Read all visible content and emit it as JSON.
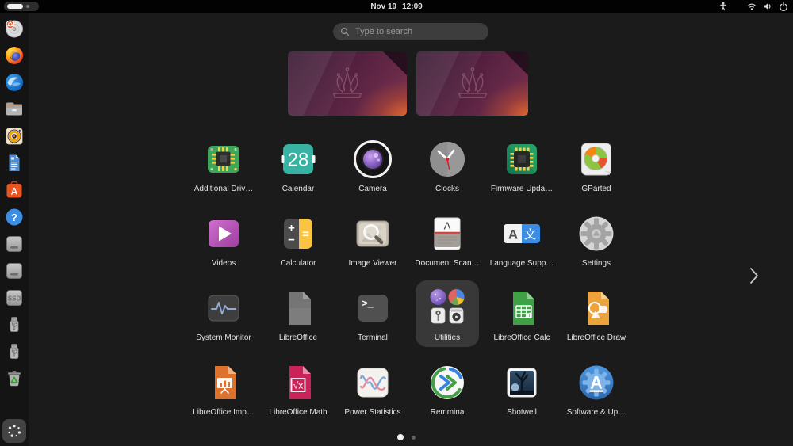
{
  "topbar": {
    "date": "Nov 19",
    "time": "12:09",
    "workspace_indicator": {
      "total": 2,
      "active": 1
    },
    "status_icons": [
      "accessibility-icon",
      "wifi-icon",
      "volume-icon",
      "power-icon"
    ]
  },
  "search": {
    "placeholder": "Type to search"
  },
  "workspaces": {
    "count": 2
  },
  "dock": {
    "items": [
      {
        "name": "install-ubuntu"
      },
      {
        "name": "firefox"
      },
      {
        "name": "thunderbird"
      },
      {
        "name": "files"
      },
      {
        "name": "rhythmbox"
      },
      {
        "name": "libreoffice-writer"
      },
      {
        "name": "app-center",
        "glyph": "A"
      },
      {
        "name": "help",
        "glyph": "?"
      },
      {
        "name": "hard-drive-1"
      },
      {
        "name": "hard-drive-2"
      },
      {
        "name": "ssd-drive",
        "glyph": "SSD"
      },
      {
        "name": "usb-drive-1"
      },
      {
        "name": "usb-drive-2"
      },
      {
        "name": "trash"
      },
      {
        "name": "show-apps"
      }
    ]
  },
  "apps": [
    {
      "label": "Additional Driv…",
      "icon": "additional-drivers-icon"
    },
    {
      "label": "Calendar",
      "icon": "calendar-icon",
      "glyph": "28"
    },
    {
      "label": "Camera",
      "icon": "camera-icon"
    },
    {
      "label": "Clocks",
      "icon": "clocks-icon"
    },
    {
      "label": "Firmware Upda…",
      "icon": "firmware-updater-icon"
    },
    {
      "label": "GParted",
      "icon": "gparted-icon"
    },
    {
      "label": "Videos",
      "icon": "videos-icon"
    },
    {
      "label": "Calculator",
      "icon": "calculator-icon",
      "glyph_plus": "+",
      "glyph_minus": "−",
      "glyph_equals": "="
    },
    {
      "label": "Image Viewer",
      "icon": "image-viewer-icon"
    },
    {
      "label": "Document Scan…",
      "icon": "document-scanner-icon",
      "glyph": "A"
    },
    {
      "label": "Language Supp…",
      "icon": "language-support-icon",
      "glyph_left": "A",
      "glyph_right": "文"
    },
    {
      "label": "Settings",
      "icon": "settings-icon"
    },
    {
      "label": "System Monitor",
      "icon": "system-monitor-icon"
    },
    {
      "label": "LibreOffice",
      "icon": "libreoffice-icon"
    },
    {
      "label": "Terminal",
      "icon": "terminal-icon",
      "glyph": ">_"
    },
    {
      "label": "Utilities",
      "icon": "utilities-folder-icon",
      "is_folder": true
    },
    {
      "label": "LibreOffice Calc",
      "icon": "libreoffice-calc-icon"
    },
    {
      "label": "LibreOffice Draw",
      "icon": "libreoffice-draw-icon"
    },
    {
      "label": "LibreOffice Imp…",
      "icon": "libreoffice-impress-icon"
    },
    {
      "label": "LibreOffice Math",
      "icon": "libreoffice-math-icon",
      "glyph": "√x"
    },
    {
      "label": "Power Statistics",
      "icon": "power-statistics-icon"
    },
    {
      "label": "Remmina",
      "icon": "remmina-icon"
    },
    {
      "label": "Shotwell",
      "icon": "shotwell-icon"
    },
    {
      "label": "Software & Up…",
      "icon": "software-updater-icon",
      "glyph": "A"
    }
  ],
  "pager": {
    "pages": 2,
    "current_page": 1
  },
  "colors": {
    "panel_bg": "#020202",
    "overview_bg": "#1b1b1b",
    "dock_bg": "#141414",
    "search_bg": "#3d3d3d",
    "folder_bg": "#383838",
    "label_color": "#e3e3e3",
    "ubuntu_orange": "#e95420",
    "accent_blue": "#3584e4",
    "wallpaper_purple": "#5a2342",
    "wallpaper_orange": "#e06b2d"
  }
}
